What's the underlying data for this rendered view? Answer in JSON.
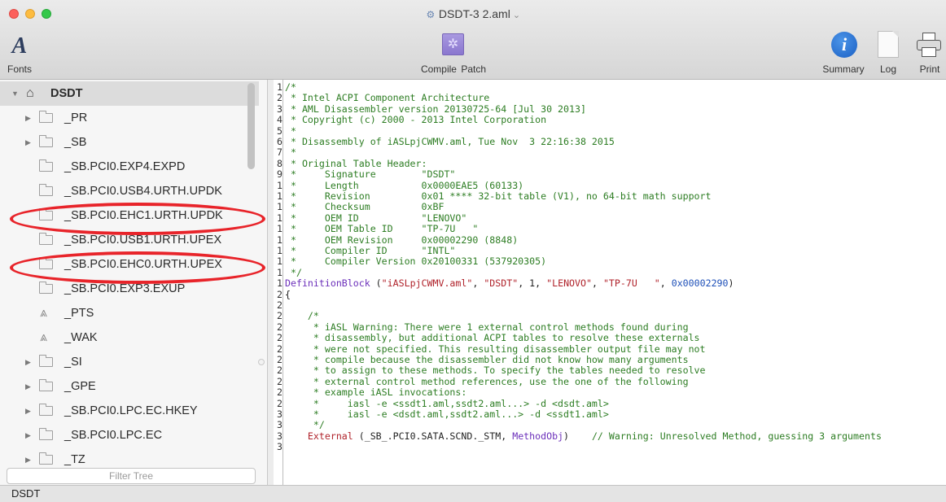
{
  "window": {
    "title": "DSDT-3 2.aml",
    "title_chevron": "⌄"
  },
  "toolbar": {
    "fonts_label": "Fonts",
    "compile_label": "Compile",
    "patch_label": "Patch",
    "summary_label": "Summary",
    "log_label": "Log",
    "print_label": "Print"
  },
  "sidebar": {
    "root": "DSDT",
    "items": [
      {
        "label": "_PR",
        "icon": "folder-icon",
        "expandable": true
      },
      {
        "label": "_SB",
        "icon": "folder-icon",
        "expandable": true
      },
      {
        "label": "_SB.PCI0.EXP4.EXPD",
        "icon": "folder-icon",
        "expandable": false
      },
      {
        "label": "_SB.PCI0.USB4.URTH.UPDK",
        "icon": "folder-icon",
        "expandable": false
      },
      {
        "label": "_SB.PCI0.EHC1.URTH.UPDK",
        "icon": "folder-icon",
        "expandable": false,
        "circled": true
      },
      {
        "label": "_SB.PCI0.USB1.URTH.UPEX",
        "icon": "folder-icon",
        "expandable": false
      },
      {
        "label": "_SB.PCI0.EHC0.URTH.UPEX",
        "icon": "folder-icon",
        "expandable": false,
        "circled": true
      },
      {
        "label": "_SB.PCI0.EXP3.EXUP",
        "icon": "folder-icon",
        "expandable": false
      },
      {
        "label": "_PTS",
        "icon": "method-icon",
        "expandable": false
      },
      {
        "label": "_WAK",
        "icon": "method-icon",
        "expandable": false
      },
      {
        "label": "_SI",
        "icon": "folder-icon",
        "expandable": true
      },
      {
        "label": "_GPE",
        "icon": "folder-icon",
        "expandable": true
      },
      {
        "label": "_SB.PCI0.LPC.EC.HKEY",
        "icon": "folder-icon",
        "expandable": true
      },
      {
        "label": "_SB.PCI0.LPC.EC",
        "icon": "folder-icon",
        "expandable": true
      },
      {
        "label": "_TZ",
        "icon": "folder-icon",
        "expandable": true
      }
    ],
    "filter_placeholder": "Filter Tree",
    "annotation_color": "#e8242a"
  },
  "editor": {
    "lines": [
      {
        "n": "1",
        "segs": [
          {
            "c": "comment",
            "t": "/*"
          }
        ]
      },
      {
        "n": "2",
        "segs": [
          {
            "c": "comment",
            "t": " * Intel ACPI Component Architecture"
          }
        ]
      },
      {
        "n": "3",
        "segs": [
          {
            "c": "comment",
            "t": " * AML Disassembler version 20130725-64 [Jul 30 2013]"
          }
        ]
      },
      {
        "n": "4",
        "segs": [
          {
            "c": "comment",
            "t": " * Copyright (c) 2000 - 2013 Intel Corporation"
          }
        ]
      },
      {
        "n": "5",
        "segs": [
          {
            "c": "comment",
            "t": " *"
          }
        ]
      },
      {
        "n": "6",
        "segs": [
          {
            "c": "comment",
            "t": " * Disassembly of iASLpjCWMV.aml, Tue Nov  3 22:16:38 2015"
          }
        ]
      },
      {
        "n": "7",
        "segs": [
          {
            "c": "comment",
            "t": " *"
          }
        ]
      },
      {
        "n": "8",
        "segs": [
          {
            "c": "comment",
            "t": " * Original Table Header:"
          }
        ]
      },
      {
        "n": "9",
        "segs": [
          {
            "c": "comment",
            "t": " *     Signature        \"DSDT\""
          }
        ]
      },
      {
        "n": "1",
        "segs": [
          {
            "c": "comment",
            "t": " *     Length           0x0000EAE5 (60133)"
          }
        ]
      },
      {
        "n": "1",
        "segs": [
          {
            "c": "comment",
            "t": " *     Revision         0x01 **** 32-bit table (V1), no 64-bit math support"
          }
        ]
      },
      {
        "n": "1",
        "segs": [
          {
            "c": "comment",
            "t": " *     Checksum         0xBF"
          }
        ]
      },
      {
        "n": "1",
        "segs": [
          {
            "c": "comment",
            "t": " *     OEM ID           \"LENOVO\""
          }
        ]
      },
      {
        "n": "1",
        "segs": [
          {
            "c": "comment",
            "t": " *     OEM Table ID     \"TP-7U   \""
          }
        ]
      },
      {
        "n": "1",
        "segs": [
          {
            "c": "comment",
            "t": " *     OEM Revision     0x00002290 (8848)"
          }
        ]
      },
      {
        "n": "1",
        "segs": [
          {
            "c": "comment",
            "t": " *     Compiler ID      \"INTL\""
          }
        ]
      },
      {
        "n": "1",
        "segs": [
          {
            "c": "comment",
            "t": " *     Compiler Version 0x20100331 (537920305)"
          }
        ]
      },
      {
        "n": "1",
        "segs": [
          {
            "c": "comment",
            "t": " */"
          }
        ]
      },
      {
        "n": "1",
        "segs": [
          {
            "c": "kw",
            "t": "DefinitionBlock"
          },
          {
            "c": "plain",
            "t": " ("
          },
          {
            "c": "str",
            "t": "\"iASLpjCWMV.aml\""
          },
          {
            "c": "plain",
            "t": ", "
          },
          {
            "c": "str",
            "t": "\"DSDT\""
          },
          {
            "c": "plain",
            "t": ", 1, "
          },
          {
            "c": "str",
            "t": "\"LENOVO\""
          },
          {
            "c": "plain",
            "t": ", "
          },
          {
            "c": "str",
            "t": "\"TP-7U   \""
          },
          {
            "c": "plain",
            "t": ", "
          },
          {
            "c": "num",
            "t": "0x00002290"
          },
          {
            "c": "plain",
            "t": ")"
          }
        ]
      },
      {
        "n": "2",
        "segs": [
          {
            "c": "plain",
            "t": "{"
          }
        ]
      },
      {
        "n": "2",
        "segs": [
          {
            "c": "plain",
            "t": ""
          }
        ]
      },
      {
        "n": "2",
        "segs": [
          {
            "c": "comment",
            "t": "    /*"
          }
        ]
      },
      {
        "n": "2",
        "segs": [
          {
            "c": "comment",
            "t": "     * iASL Warning: There were 1 external control methods found during"
          }
        ]
      },
      {
        "n": "2",
        "segs": [
          {
            "c": "comment",
            "t": "     * disassembly, but additional ACPI tables to resolve these externals"
          }
        ]
      },
      {
        "n": "2",
        "segs": [
          {
            "c": "comment",
            "t": "     * were not specified. This resulting disassembler output file may not"
          }
        ]
      },
      {
        "n": "2",
        "segs": [
          {
            "c": "comment",
            "t": "     * compile because the disassembler did not know how many arguments"
          }
        ]
      },
      {
        "n": "2",
        "segs": [
          {
            "c": "comment",
            "t": "     * to assign to these methods. To specify the tables needed to resolve"
          }
        ]
      },
      {
        "n": "2",
        "segs": [
          {
            "c": "comment",
            "t": "     * external control method references, use the one of the following"
          }
        ]
      },
      {
        "n": "2",
        "segs": [
          {
            "c": "comment",
            "t": "     * example iASL invocations:"
          }
        ]
      },
      {
        "n": "2",
        "segs": [
          {
            "c": "comment",
            "t": "     *     iasl -e <ssdt1.aml,ssdt2.aml...> -d <dsdt.aml>"
          }
        ]
      },
      {
        "n": "3",
        "segs": [
          {
            "c": "comment",
            "t": "     *     iasl -e <dsdt.aml,ssdt2.aml...> -d <ssdt1.aml>"
          }
        ]
      },
      {
        "n": "3",
        "segs": [
          {
            "c": "comment",
            "t": "     */"
          }
        ]
      },
      {
        "n": "3",
        "segs": [
          {
            "c": "plain",
            "t": "    "
          },
          {
            "c": "str",
            "t": "External"
          },
          {
            "c": "plain",
            "t": " (_SB_.PCI0.SATA.SCND._STM, "
          },
          {
            "c": "kw",
            "t": "MethodObj"
          },
          {
            "c": "plain",
            "t": ")    "
          },
          {
            "c": "comment",
            "t": "// Warning: Unresolved Method, guessing 3 arguments"
          }
        ]
      },
      {
        "n": "3",
        "segs": [
          {
            "c": "plain",
            "t": ""
          }
        ]
      }
    ]
  },
  "status": {
    "text": "DSDT"
  }
}
